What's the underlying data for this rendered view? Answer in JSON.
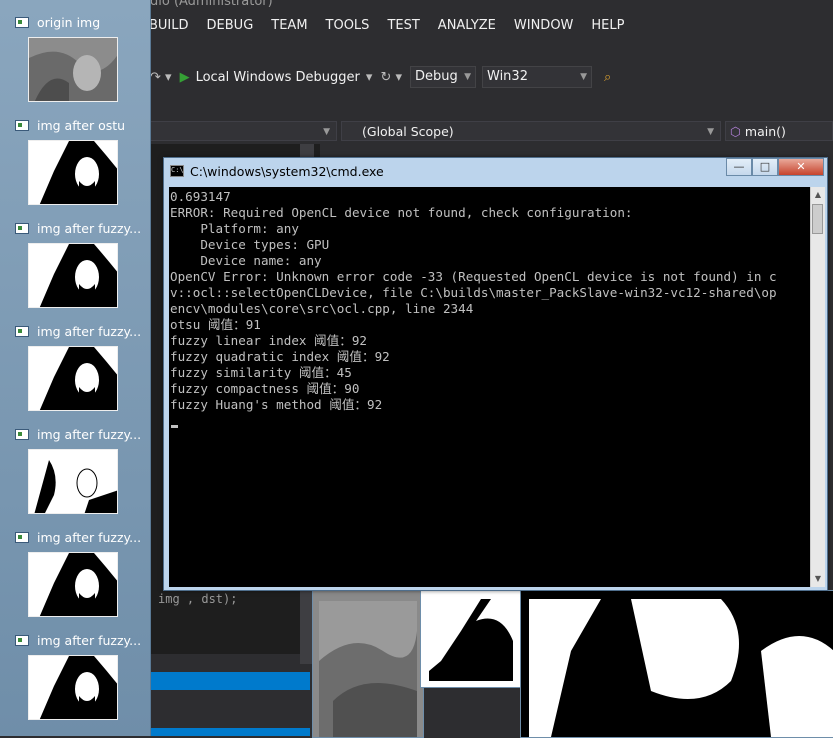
{
  "vs": {
    "title_fragment": "dio (Administrator)",
    "menu": [
      "BUILD",
      "DEBUG",
      "TEAM",
      "TOOLS",
      "TEST",
      "ANALYZE",
      "WINDOW",
      "HELP"
    ],
    "toolbar": {
      "debugger_label": "Local Windows Debugger",
      "configuration": "Debug",
      "platform": "Win32"
    },
    "nav": {
      "scope": "(Global Scope)",
      "function": "main()"
    },
    "code_fragment": "img , dst);"
  },
  "sidebar": {
    "items": [
      {
        "label": "origin img",
        "kind": "gray"
      },
      {
        "label": "img after ostu",
        "kind": "bw"
      },
      {
        "label": "img after fuzzy...",
        "kind": "bw"
      },
      {
        "label": "img after fuzzy...",
        "kind": "bw"
      },
      {
        "label": "img after fuzzy...",
        "kind": "light"
      },
      {
        "label": "img after fuzzy...",
        "kind": "bw"
      },
      {
        "label": "img after fuzzy...",
        "kind": "bw"
      }
    ]
  },
  "cmd": {
    "title": "C:\\windows\\system32\\cmd.exe",
    "buttons": {
      "minimize": "—",
      "maximize": "□",
      "close": "✕"
    },
    "lines": [
      "0.693147",
      "ERROR: Required OpenCL device not found, check configuration:",
      "    Platform: any",
      "    Device types: GPU",
      "    Device name: any",
      "OpenCV Error: Unknown error code -33 (Requested OpenCL device is not found) in c",
      "v::ocl::selectOpenCLDevice, file C:\\builds\\master_PackSlave-win32-vc12-shared\\op",
      "encv\\modules\\core\\src\\ocl.cpp, line 2344",
      "otsu 阈值：91",
      "fuzzy linear index 阈值：92",
      "fuzzy quadratic index 阈值：92",
      "fuzzy similarity 阈值：45",
      "fuzzy compactness 阈值：90",
      "fuzzy Huang's method 阈值：92"
    ]
  },
  "colors": {
    "vs_bg": "#2d2d30",
    "accent_blue": "#007acc",
    "console_text": "#c0c0c0",
    "console_bg": "#000000",
    "window_frame": "#bcd4ec"
  }
}
